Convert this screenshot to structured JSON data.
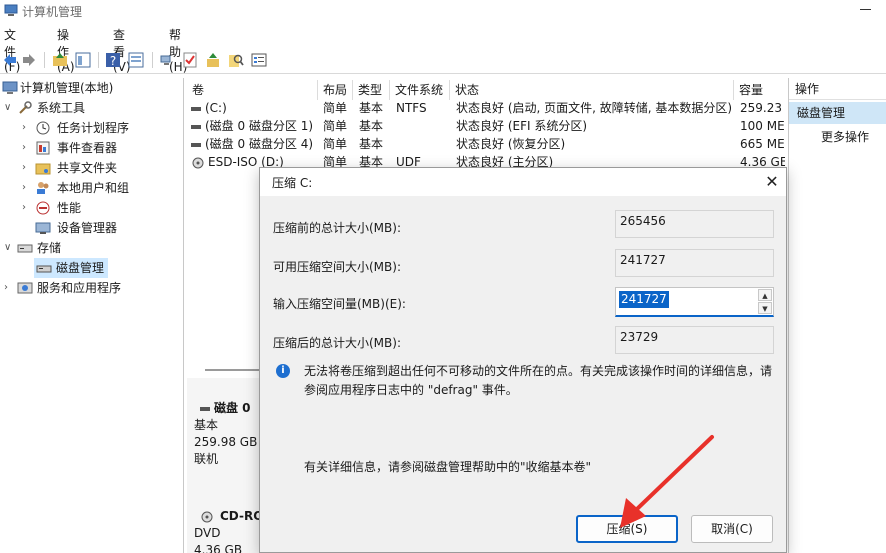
{
  "window": {
    "title": "计算机管理"
  },
  "menu": [
    "文件(F)",
    "操作(A)",
    "查看(V)",
    "帮助(H)"
  ],
  "toolbar": {
    "icons": [
      "back-icon",
      "forward-icon",
      "up-folder-icon",
      "show-hide-tree-icon",
      "help-icon",
      "view-icon",
      "connect-icon",
      "checklist-icon",
      "import-icon",
      "search-icon",
      "properties-icon"
    ]
  },
  "tree": {
    "root": "计算机管理(本地)",
    "system_tools": "系统工具",
    "items": [
      "任务计划程序",
      "事件查看器",
      "共享文件夹",
      "本地用户和组",
      "性能",
      "设备管理器"
    ],
    "storage": "存储",
    "disk_mgmt": "磁盘管理",
    "services": "服务和应用程序"
  },
  "columns": [
    "卷",
    "布局",
    "类型",
    "文件系统",
    "状态",
    "容量"
  ],
  "volumes": [
    {
      "name": "(C:)",
      "layout": "简单",
      "type": "基本",
      "fs": "NTFS",
      "status": "状态良好 (启动, 页面文件, 故障转储, 基本数据分区)",
      "cap": "259.23"
    },
    {
      "name": "(磁盘 0 磁盘分区 1)",
      "layout": "简单",
      "type": "基本",
      "fs": "",
      "status": "状态良好 (EFI 系统分区)",
      "cap": "100 ME"
    },
    {
      "name": "(磁盘 0 磁盘分区 4)",
      "layout": "简单",
      "type": "基本",
      "fs": "",
      "status": "状态良好 (恢复分区)",
      "cap": "665 ME"
    },
    {
      "name": "ESD-ISO (D:)",
      "layout": "简单",
      "type": "基本",
      "fs": "UDF",
      "status": "状态良好 (主分区)",
      "cap": "4.36 GE"
    }
  ],
  "disks": [
    {
      "name": "磁盘 0",
      "type": "基本",
      "size": "259.98 GB",
      "state": "联机"
    },
    {
      "name": "CD-RO",
      "type": "DVD",
      "size": "4.36 GB"
    }
  ],
  "actions": {
    "header": "操作",
    "selected": "磁盘管理",
    "more": "更多操作"
  },
  "dialog": {
    "title": "压缩 C:",
    "total_before_label": "压缩前的总计大小(MB):",
    "total_before": "265456",
    "available_label": "可用压缩空间大小(MB):",
    "available": "241727",
    "input_label": "输入压缩空间量(MB)(E):",
    "input_value": "241727",
    "total_after_label": "压缩后的总计大小(MB):",
    "total_after": "23729",
    "info_text": "无法将卷压缩到超出任何不可移动的文件所在的点。有关完成该操作时间的详细信息，请参阅应用程序日志中的 \"defrag\" 事件。",
    "more_info": "有关详细信息，请参阅磁盘管理帮助中的\"收缩基本卷\"",
    "shrink_button": "压缩(S)",
    "cancel_button": "取消(C)",
    "close": "✕"
  },
  "colors": {
    "accent": "#0a64c8",
    "selection": "#cde8ff",
    "arrow": "#e8312a"
  }
}
